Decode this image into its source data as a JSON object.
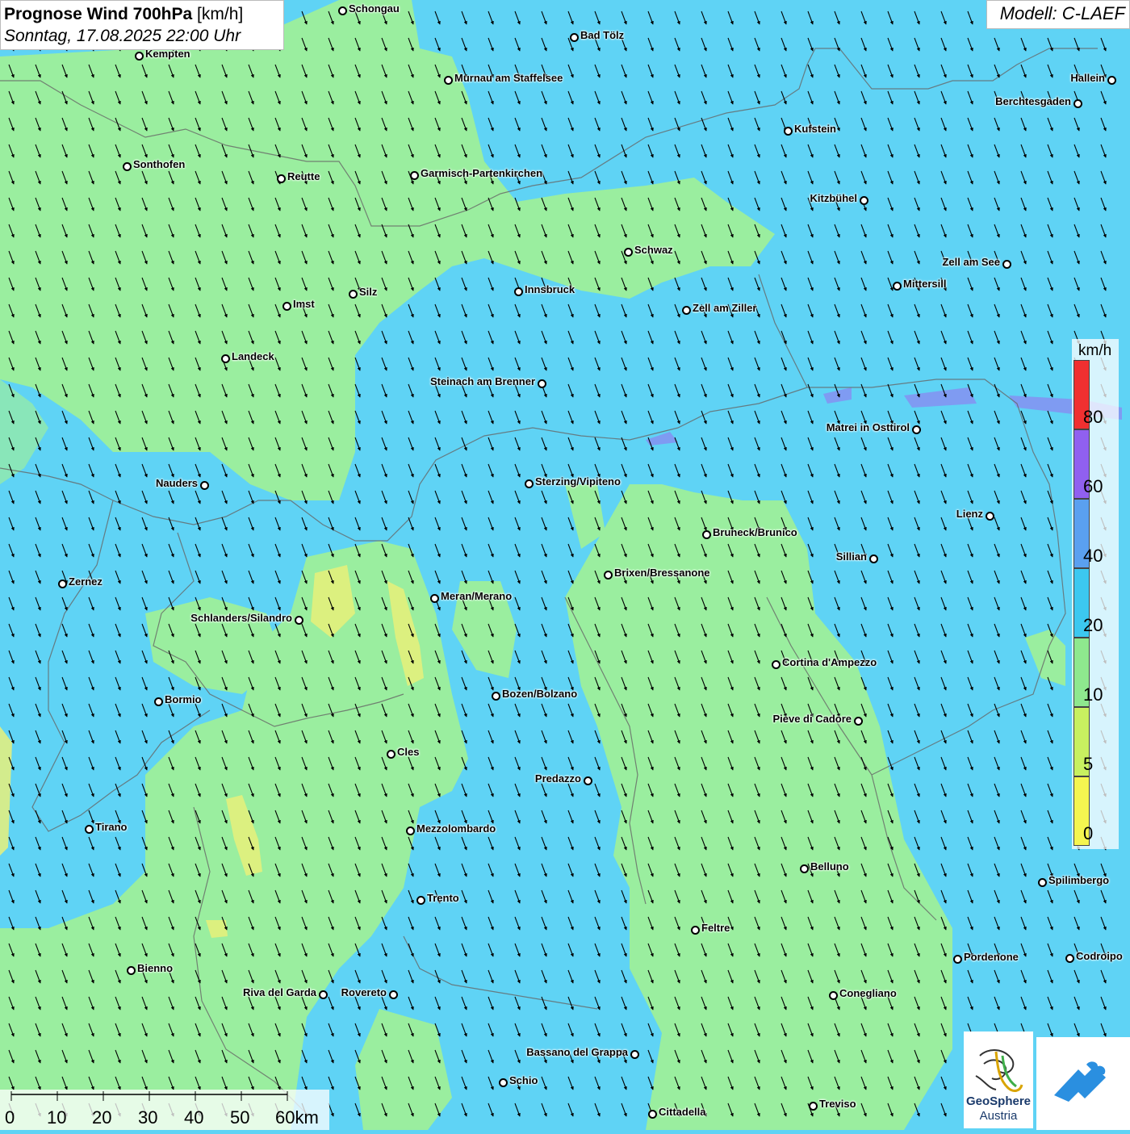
{
  "header": {
    "title_bold": "Prognose Wind 700hPa",
    "title_unit": " [km/h]",
    "subtitle": "Sonntag, 17.08.2025 22:00 Uhr",
    "model": "Modell: C-LAEF"
  },
  "legend": {
    "unit": "km/h",
    "bands": [
      {
        "from": 0,
        "to": 5,
        "color": "#f5f550"
      },
      {
        "from": 5,
        "to": 10,
        "color": "#c8f060"
      },
      {
        "from": 10,
        "to": 20,
        "color": "#8ee88e"
      },
      {
        "from": 20,
        "to": 40,
        "color": "#3cc8f0"
      },
      {
        "from": 40,
        "to": 60,
        "color": "#5aa0f0"
      },
      {
        "from": 60,
        "to": 80,
        "color": "#9060f0"
      },
      {
        "from": 80,
        "to": 100,
        "color": "#f03030"
      }
    ],
    "ticks": [
      "0",
      "5",
      "10",
      "20",
      "40",
      "60",
      "80"
    ]
  },
  "scalebar": {
    "labels": [
      "0",
      "10",
      "20",
      "30",
      "40",
      "50",
      "60km"
    ]
  },
  "branding": {
    "org_line1": "GeoSphere",
    "org_line2": "Austria"
  },
  "colors": {
    "wind_low": "#9ef09a",
    "wind_mid": "#5fd3f5",
    "wind_high": "#5aa0f0",
    "wind_very_low": "#e8f07a",
    "arrow": "#000000"
  },
  "wind_direction": "from north-northwest (arrows pointing south-southeast)",
  "cities": [
    "Schongau",
    "Bad Tölz",
    "Kempten",
    "Murnau am Staffelsee",
    "Hallein",
    "Berchtesgaden",
    "Kufstein",
    "Sonthofen",
    "Reutte",
    "Garmisch-Partenkirchen",
    "Kitzbühel",
    "Schwaz",
    "Zell am See",
    "Mittersill",
    "Innsbruck",
    "Silz",
    "Imst",
    "Zell am Ziller",
    "Landeck",
    "Steinach am Brenner",
    "Matrei in Osttirol",
    "Nauders",
    "Sterzing/Vipiteno",
    "Lienz",
    "Bruneck/Brunico",
    "Sillian",
    "Brixen/Bressanone",
    "Zernez",
    "Meran/Merano",
    "Schlanders/Silandro",
    "Cortina d'Ampezzo",
    "Bozen/Bolzano",
    "Bormio",
    "Pieve di Cadore",
    "Cles",
    "Predazzo",
    "Tirano",
    "Mezzolombardo",
    "Belluno",
    "Spilimbergo",
    "Trento",
    "Feltre",
    "Pordenone",
    "Codroipo",
    "Bienno",
    "Riva del Garda",
    "Rovereto",
    "Conegliano",
    "Bassano del Grappa",
    "Schio",
    "Treviso",
    "Cittadella"
  ]
}
